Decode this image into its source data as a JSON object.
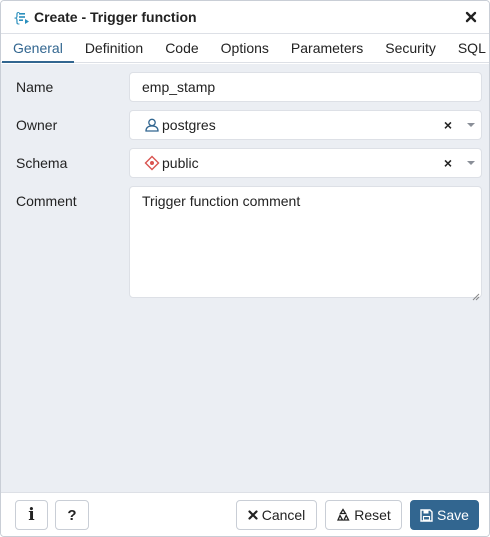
{
  "dialog": {
    "title": "Create - Trigger function",
    "title_icon": "trigger-function-icon",
    "close_icon": "close-icon"
  },
  "tabs": [
    {
      "label": "General",
      "active": true
    },
    {
      "label": "Definition",
      "active": false
    },
    {
      "label": "Code",
      "active": false
    },
    {
      "label": "Options",
      "active": false
    },
    {
      "label": "Parameters",
      "active": false
    },
    {
      "label": "Security",
      "active": false
    },
    {
      "label": "SQL",
      "active": false
    }
  ],
  "form": {
    "name": {
      "label": "Name",
      "value": "emp_stamp"
    },
    "owner": {
      "label": "Owner",
      "value": "postgres",
      "icon": "user-icon",
      "clear": "×"
    },
    "schema": {
      "label": "Schema",
      "value": "public",
      "icon": "schema-icon",
      "clear": "×"
    },
    "comment": {
      "label": "Comment",
      "value": "Trigger function comment"
    }
  },
  "footer": {
    "info_label": "i",
    "help_label": "?",
    "cancel_label": "Cancel",
    "reset_label": "Reset",
    "save_label": "Save"
  },
  "colors": {
    "accent": "#326690",
    "content_bg": "#ebeef3",
    "schema_icon": "#d9534f",
    "title_icon": "#2a8fbd"
  }
}
